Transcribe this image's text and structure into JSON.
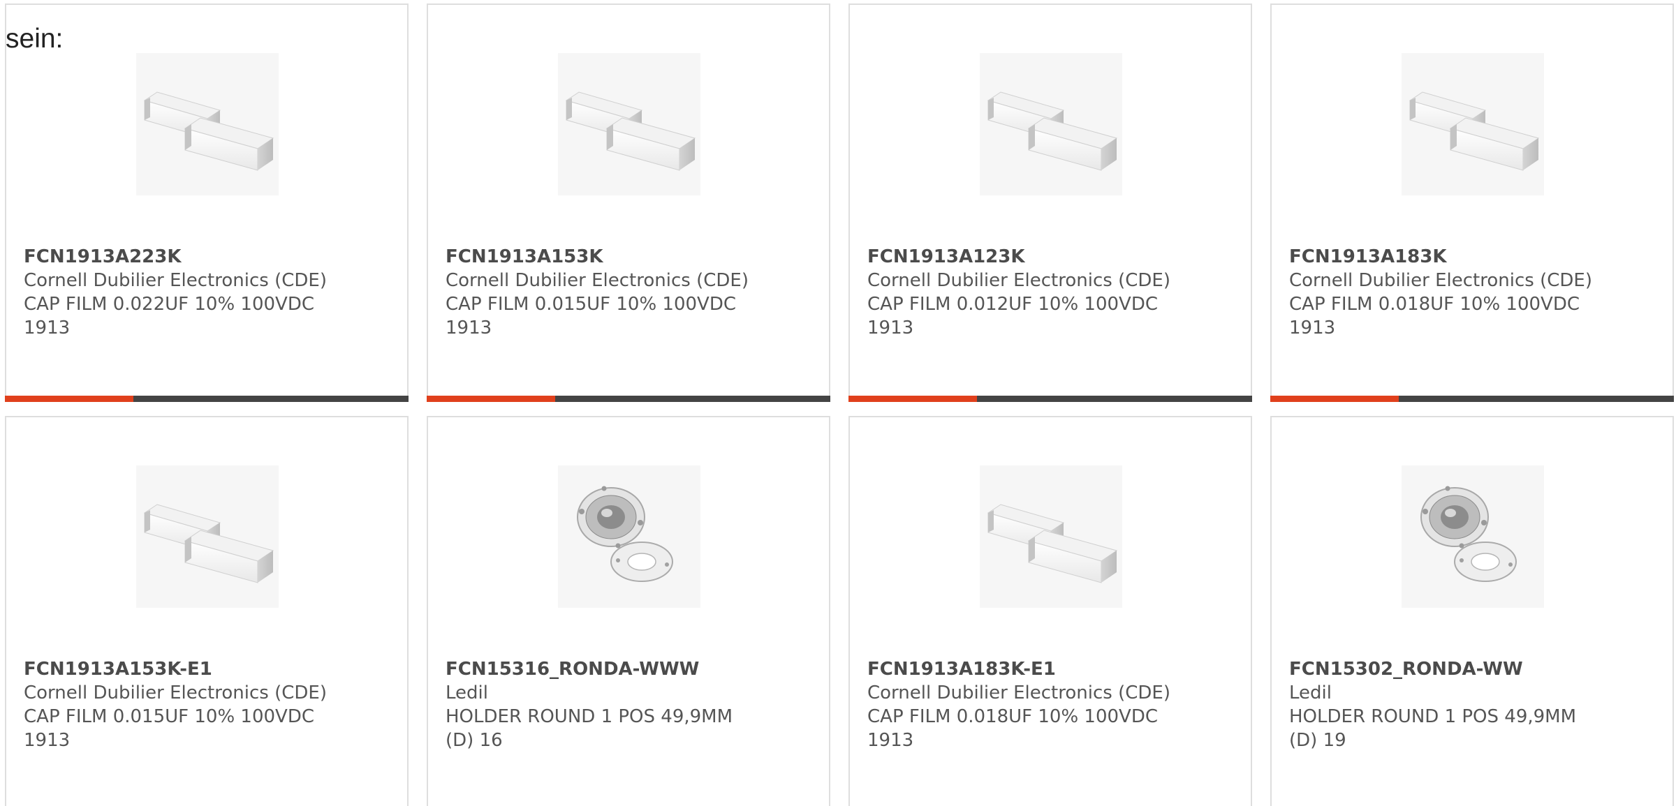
{
  "intro_text": "sein:",
  "colors": {
    "accent": "#e0401c",
    "bar": "#444444",
    "border": "#dedede"
  },
  "products": [
    {
      "part_number": "FCN1913A223K",
      "manufacturer": "Cornell Dubilier Electronics (CDE)",
      "desc_line1": "CAP FILM 0.022UF 10% 100VDC",
      "desc_line2": "1913",
      "image": "film-capacitor-icon"
    },
    {
      "part_number": "FCN1913A153K",
      "manufacturer": "Cornell Dubilier Electronics (CDE)",
      "desc_line1": "CAP FILM 0.015UF 10% 100VDC",
      "desc_line2": "1913",
      "image": "film-capacitor-icon"
    },
    {
      "part_number": "FCN1913A123K",
      "manufacturer": "Cornell Dubilier Electronics (CDE)",
      "desc_line1": "CAP FILM 0.012UF 10% 100VDC",
      "desc_line2": "1913",
      "image": "film-capacitor-icon"
    },
    {
      "part_number": "FCN1913A183K",
      "manufacturer": "Cornell Dubilier Electronics (CDE)",
      "desc_line1": "CAP FILM 0.018UF 10% 100VDC",
      "desc_line2": "1913",
      "image": "film-capacitor-icon"
    },
    {
      "part_number": "FCN1913A153K-E1",
      "manufacturer": "Cornell Dubilier Electronics (CDE)",
      "desc_line1": "CAP FILM 0.015UF 10% 100VDC",
      "desc_line2": "1913",
      "image": "film-capacitor-icon"
    },
    {
      "part_number": "FCN15316_RONDA-WWW",
      "manufacturer": "Ledil",
      "desc_line1": "HOLDER ROUND 1 POS 49,9MM",
      "desc_line2": "(D) 16",
      "image": "round-holder-icon"
    },
    {
      "part_number": "FCN1913A183K-E1",
      "manufacturer": "Cornell Dubilier Electronics (CDE)",
      "desc_line1": "CAP FILM 0.018UF 10% 100VDC",
      "desc_line2": "1913",
      "image": "film-capacitor-icon"
    },
    {
      "part_number": "FCN15302_RONDA-WW",
      "manufacturer": "Ledil",
      "desc_line1": "HOLDER ROUND 1 POS 49,9MM",
      "desc_line2": "(D) 19",
      "image": "round-holder-icon"
    }
  ]
}
